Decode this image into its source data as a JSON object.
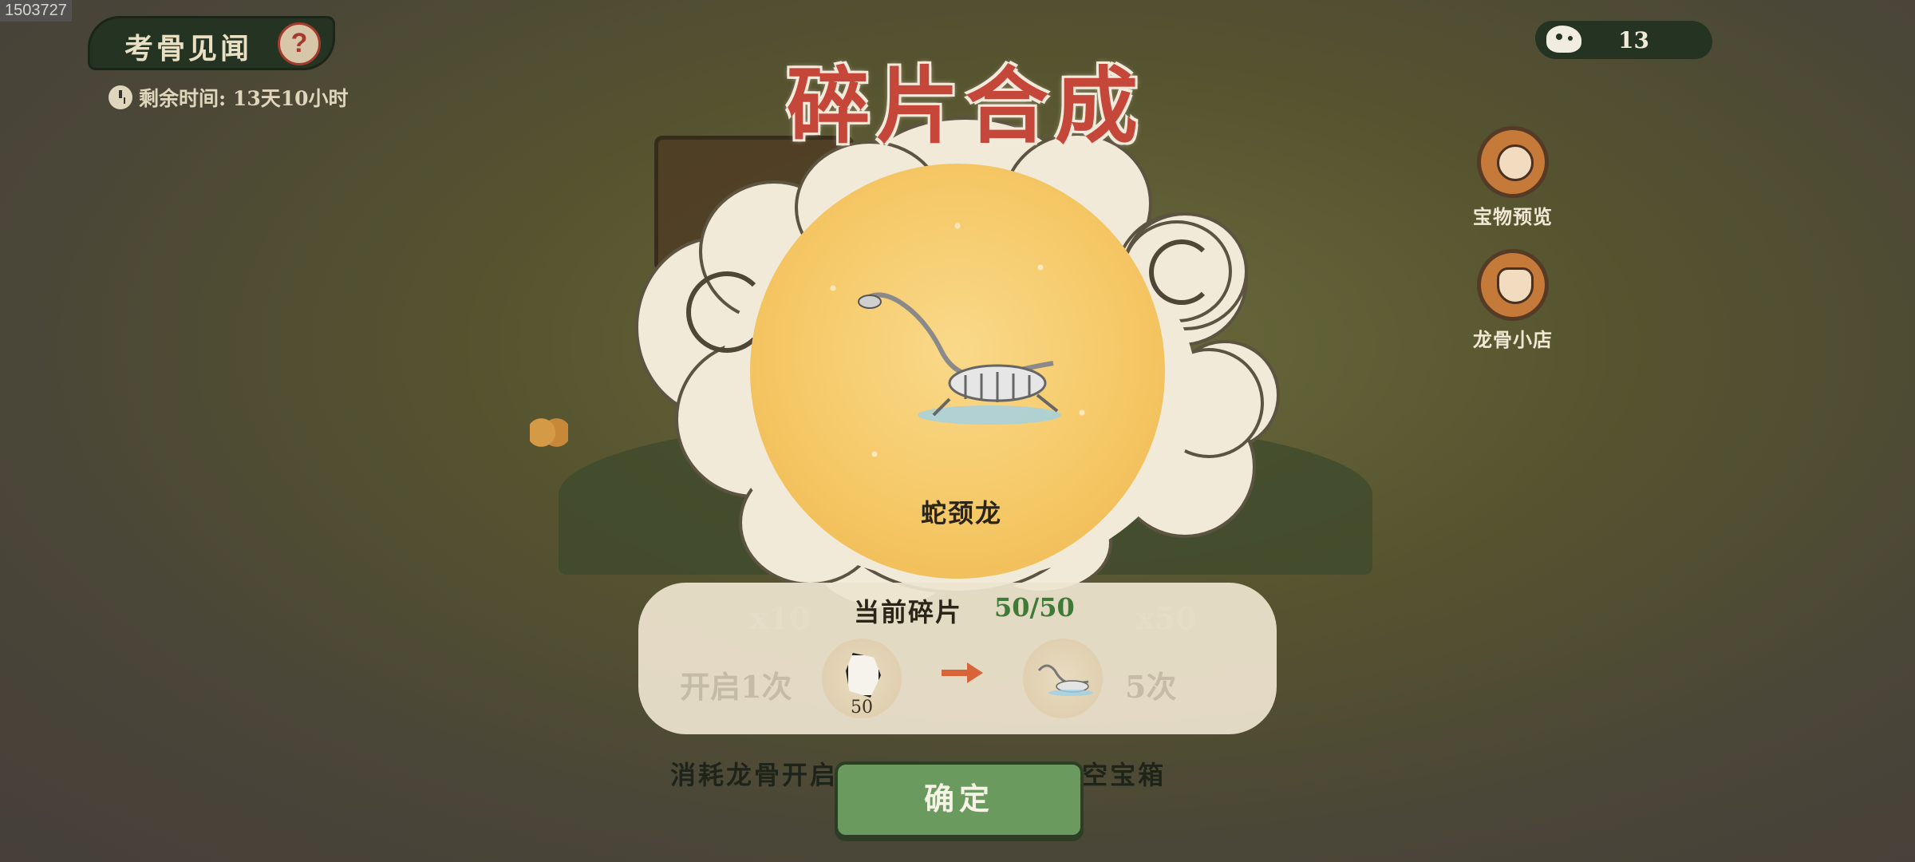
{
  "id_tag": "1503727",
  "event": {
    "title": "考骨见闻",
    "help_icon": "question-icon",
    "timer": "剩余时间: 13天10小时"
  },
  "currency": {
    "icon": "skull-icon",
    "value": "13"
  },
  "side_buttons": [
    {
      "label": "宝物预览",
      "icon": "treasure-preview-icon"
    },
    {
      "label": "龙骨小店",
      "icon": "dragon-bone-shop-icon"
    }
  ],
  "dialog": {
    "title": "碎片合成",
    "creature_name": "蛇颈龙",
    "current_fragments_label": "当前碎片",
    "current_fragments_value": "50/50",
    "cost_token_count": "50",
    "confirm_label": "确定"
  },
  "background": {
    "hint_text_left": "消耗龙骨开启",
    "hint_text_right": "次 抽空宝箱",
    "ghost_x10": "x10",
    "ghost_x50": "x50",
    "ghost_open_once": "开启1次",
    "ghost_open_five": "5次"
  },
  "colors": {
    "title_red": "#c4473a",
    "fragment_green": "#3f7a36",
    "button_green": "#6b9a5e"
  }
}
